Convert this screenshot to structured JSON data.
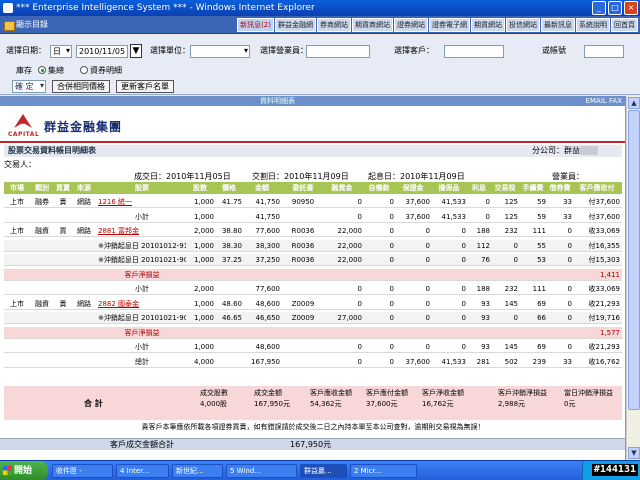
{
  "window": {
    "title": "*** Enterprise Intelligence System *** - Windows Internet Explorer"
  },
  "menubar": {
    "home": "顯示目錄",
    "items": [
      "新訊息(2)",
      "群益金融網",
      "券商網站",
      "期貨商網站",
      "證券網站",
      "證券電子網",
      "期貨網站",
      "投信網站",
      "最新訊息",
      "系統說明",
      "回首頁"
    ]
  },
  "query": {
    "date_label": "選擇日期：",
    "date_unit": "日",
    "date_value": "2010/11/05",
    "unit_label": "選擇單位：",
    "broker_label": "選擇營業員：",
    "client_label": "選擇客戶：",
    "account_label": "或帳號",
    "inventory_label": "庫存",
    "radio_all": "集總",
    "radio_detail": "資券明細",
    "condition_value": "確 定",
    "btn_merge": "合併相同價格",
    "btn_client": "更新客戶名單"
  },
  "report": {
    "top_bar_center": "資料明細表",
    "top_bar_right": "EMAIL   FAX",
    "logo_en": "CAPITAL",
    "logo_cn": "群益金融集團",
    "title": "股票交易資料帳目明細表",
    "branch_label": "分公司：群益",
    "trader_label": "交易人：",
    "deal_date_label": "成交日：2010年11月05日",
    "settle_date_label": "交割日：2010年11月09日",
    "start_date_label": "起息日：2010年11月09日",
    "sales_label": "營業員："
  },
  "table": {
    "headers": [
      "市場",
      "類別",
      "買賣",
      "來源",
      "股票",
      "股數",
      "價格",
      "金額",
      "委託書",
      "融資金",
      "自備款",
      "保證金",
      "擔保品",
      "利息",
      "交易稅",
      "手續費",
      "借券費",
      "客戶應收付"
    ],
    "rows": [
      {
        "kind": "normal",
        "cells": [
          "上市",
          "融券",
          "賣",
          "網路",
          "1216 統一",
          "1,000",
          "41.75",
          "41,750",
          "90950",
          "0",
          "0",
          "37,600",
          "41,533",
          "0",
          "125",
          "59",
          "33",
          "付37,600"
        ]
      },
      {
        "kind": "normal",
        "cells": [
          "",
          "",
          "",
          "",
          "小計",
          "1,000",
          "",
          "41,750",
          "",
          "0",
          "0",
          "37,600",
          "41,533",
          "0",
          "125",
          "59",
          "33",
          "付37,600"
        ]
      },
      {
        "kind": "normal",
        "cells": [
          "上市",
          "融資",
          "買",
          "網路",
          "2881 富邦金",
          "2,000",
          "38.80",
          "77,600",
          "R0036",
          "22,000",
          "0",
          "0",
          "0",
          "188",
          "232",
          "111",
          "0",
          "收33,069"
        ]
      },
      {
        "kind": "gray",
        "cells": [
          "",
          "",
          "",
          "",
          "※沖銷起息日 20101012-91536",
          "1,000",
          "38.30",
          "38,300",
          "R0036",
          "22,000",
          "0",
          "0",
          "0",
          "112",
          "0",
          "55",
          "0",
          "付16,355"
        ]
      },
      {
        "kind": "gray",
        "cells": [
          "",
          "",
          "",
          "",
          "※沖銷起息日 20101021-90659",
          "1,000",
          "37.25",
          "37,250",
          "R0036",
          "22,000",
          "0",
          "0",
          "0",
          "76",
          "0",
          "53",
          "0",
          "付15,303"
        ]
      },
      {
        "kind": "pink",
        "cells": [
          "",
          "",
          "",
          "",
          "客戶淨損益",
          "",
          "",
          "",
          "",
          "",
          "",
          "",
          "",
          "",
          "",
          "",
          "",
          "1,411"
        ]
      },
      {
        "kind": "normal",
        "cells": [
          "",
          "",
          "",
          "",
          "小計",
          "2,000",
          "",
          "77,600",
          "",
          "0",
          "0",
          "0",
          "0",
          "188",
          "232",
          "111",
          "0",
          "收33,069"
        ]
      },
      {
        "kind": "normal",
        "cells": [
          "上市",
          "融資",
          "賣",
          "網路",
          "2882 國泰金",
          "1,000",
          "48.60",
          "48,600",
          "Z0009",
          "0",
          "0",
          "0",
          "0",
          "93",
          "145",
          "69",
          "0",
          "收21,293"
        ]
      },
      {
        "kind": "gray",
        "cells": [
          "",
          "",
          "",
          "",
          "※沖銷起息日 20101021-90765",
          "1,000",
          "46.65",
          "46,650",
          "Z0009",
          "27,000",
          "0",
          "0",
          "0",
          "93",
          "0",
          "66",
          "0",
          "付19,716"
        ]
      },
      {
        "kind": "pink",
        "cells": [
          "",
          "",
          "",
          "",
          "客戶淨損益",
          "",
          "",
          "",
          "",
          "",
          "",
          "",
          "",
          "",
          "",
          "",
          "",
          "1,577"
        ]
      },
      {
        "kind": "normal",
        "cells": [
          "",
          "",
          "",
          "",
          "小計",
          "1,000",
          "",
          "48,600",
          "",
          "0",
          "0",
          "0",
          "0",
          "93",
          "145",
          "69",
          "0",
          "收21,293"
        ]
      },
      {
        "kind": "normal",
        "cells": [
          "",
          "",
          "",
          "",
          "總計",
          "4,000",
          "",
          "167,950",
          "",
          "0",
          "0",
          "37,600",
          "41,533",
          "281",
          "502",
          "239",
          "33",
          "收16,762"
        ]
      }
    ],
    "grand_total": {
      "label": "合 計",
      "headers": [
        "成交股數",
        "成交金額",
        "客戶應收金額",
        "客戶應付金額",
        "客戶淨收金額",
        "客戶沖銷淨損益",
        "當日沖銷淨損益"
      ],
      "values": [
        "4,000股",
        "167,950元",
        "54,362元",
        "37,600元",
        "16,762元",
        "2,988元",
        "0元"
      ]
    },
    "note": "貴客戶本筆應依所載各項證券買賣，如有錯誤請於成交後二日之內持本單至本公司查對，逾期則交易視為無誤！",
    "footer_label": "客戶成交金額合計",
    "footer_value": "167,950元"
  },
  "taskbar": {
    "start": "開始",
    "items": [
      "收件匣 -",
      "4 Inter...",
      "新世紀...",
      "5 Wind...",
      "群益贏...",
      "2 Micr..."
    ]
  },
  "watermark": "#144131"
}
